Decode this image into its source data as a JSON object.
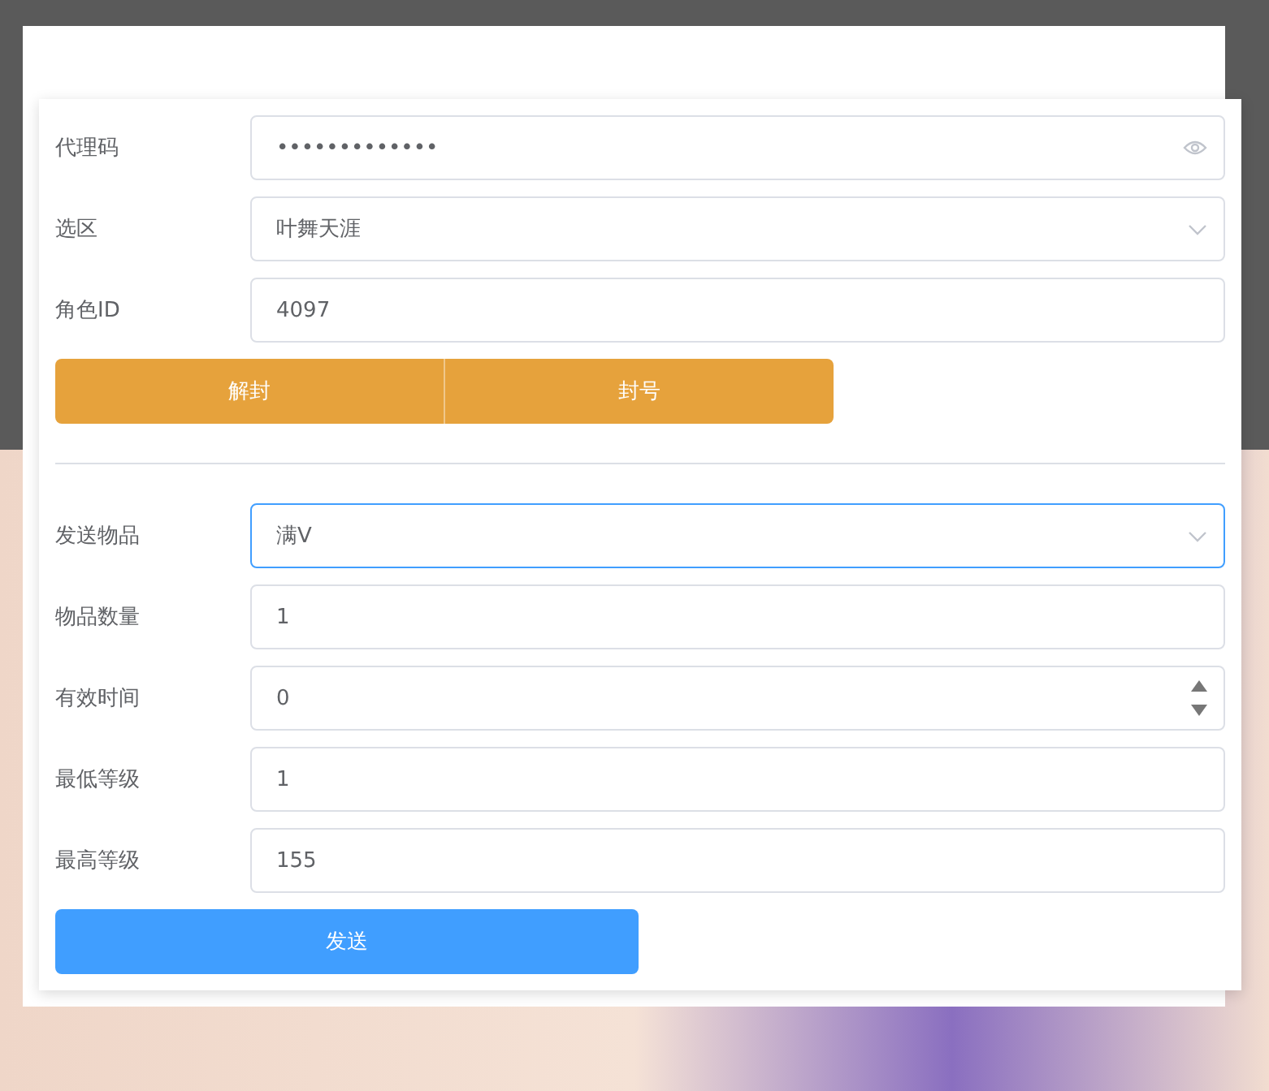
{
  "account_form": {
    "fields": [
      {
        "label": "代理码",
        "kind": "password",
        "value": "•••••••••••••",
        "focused": false
      },
      {
        "label": "选区",
        "kind": "select",
        "value": "叶舞天涯",
        "focused": false
      },
      {
        "label": "角色ID",
        "kind": "text",
        "value": "4097",
        "focused": false
      }
    ],
    "buttons": [
      "解封",
      "封号"
    ]
  },
  "item_form": {
    "fields": [
      {
        "label": "发送物品",
        "kind": "select",
        "value": "满V",
        "focused": true
      },
      {
        "label": "物品数量",
        "kind": "text",
        "value": "1",
        "focused": false
      },
      {
        "label": "有效时间",
        "kind": "number",
        "value": "0",
        "focused": false
      },
      {
        "label": "最低等级",
        "kind": "text",
        "value": "1",
        "focused": false
      },
      {
        "label": "最高等级",
        "kind": "text",
        "value": "155",
        "focused": false
      }
    ],
    "submit": "发送"
  }
}
